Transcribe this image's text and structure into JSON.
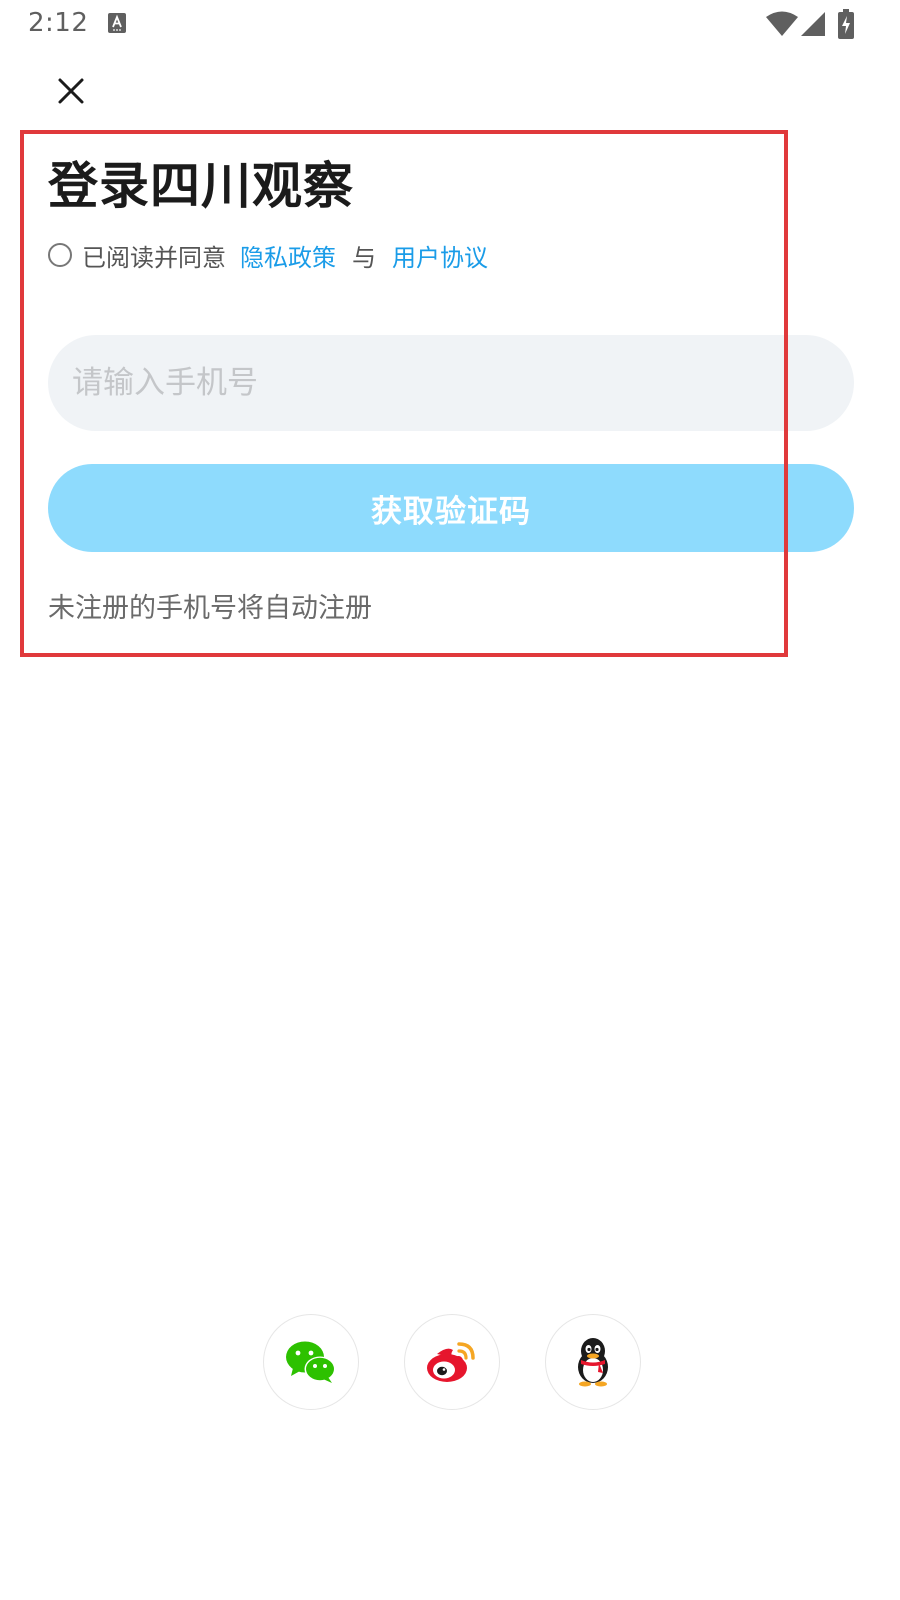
{
  "status_bar": {
    "time": "2:12",
    "icons": [
      "keyboard-a-icon",
      "wifi-icon",
      "signal-icon",
      "battery-charging-icon"
    ]
  },
  "nav": {
    "close_icon": "close-icon"
  },
  "login": {
    "title": "登录四川观察",
    "agreement_prefix": "已阅读并同意",
    "privacy_link": "隐私政策",
    "separator": "与",
    "user_agreement_link": "用户协议",
    "phone_placeholder": "请输入手机号",
    "phone_value": "",
    "get_code_label": "获取验证码",
    "auto_register_note": "未注册的手机号将自动注册"
  },
  "social_login": {
    "buttons": [
      "wechat-icon",
      "weibo-icon",
      "qq-icon"
    ]
  },
  "colors": {
    "link": "#1a9ce8",
    "button_bg": "#8edbfd",
    "input_bg": "#f0f3f6",
    "highlight": "#e0393b",
    "wechat": "#2dc100",
    "weibo": "#e6162d",
    "weibo_accent": "#f5a623"
  }
}
